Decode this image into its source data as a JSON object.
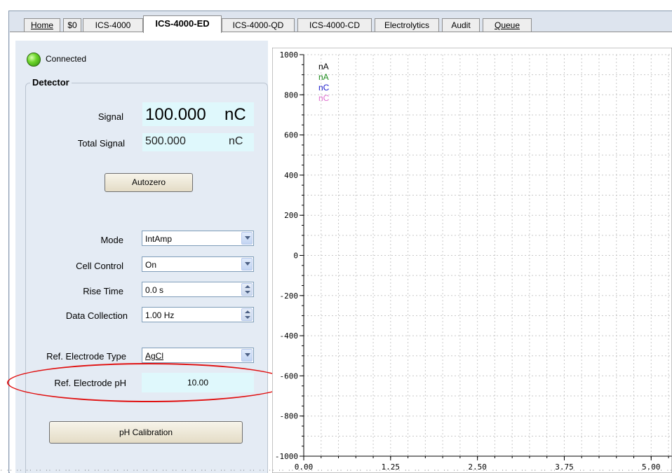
{
  "tabs": [
    {
      "label": "Home",
      "active": false
    },
    {
      "label": "$0",
      "active": false
    },
    {
      "label": "ICS-4000",
      "active": false
    },
    {
      "label": "ICS-4000-ED",
      "active": true
    },
    {
      "label": "ICS-4000-QD",
      "active": false
    },
    {
      "label": "ICS-4000-CD",
      "active": false
    },
    {
      "label": "Electrolytics",
      "active": false
    },
    {
      "label": "Audit",
      "active": false
    },
    {
      "label": "Queue",
      "active": false
    }
  ],
  "status": {
    "label": "Connected"
  },
  "detector": {
    "title": "Detector",
    "signal_label": "Signal",
    "signal_value": "100.000",
    "signal_unit": "nC",
    "total_label": "Total Signal",
    "total_value": "500.000",
    "total_unit": "nC",
    "autozero_label": "Autozero",
    "mode_label": "Mode",
    "mode_value": "IntAmp",
    "cell_label": "Cell Control",
    "cell_value": "On",
    "rise_label": "Rise Time",
    "rise_value": "0.0 s",
    "collection_label": "Data Collection",
    "collection_value": "1.00 Hz",
    "electrode_type_label": "Ref. Electrode Type",
    "electrode_type_value": "AgCl",
    "electrode_ph_label": "Ref. Electrode pH",
    "electrode_ph_value": "10.00",
    "ph_button_label": "pH Calibration"
  },
  "colors": {
    "accent_highlight": "#e01010",
    "value_bg": "#dff8fc",
    "panel_bg": "#e4ebf4"
  },
  "chart_data": {
    "type": "line",
    "yticks": [
      "1000",
      "800",
      "600",
      "400",
      "200",
      "0",
      "-200",
      "-400",
      "-600",
      "-800",
      "-1000"
    ],
    "xticks": [
      "0.00",
      "1.25",
      "2.50",
      "3.75",
      "5.00"
    ],
    "ylim": [
      -1000,
      1000
    ],
    "xlim": [
      0,
      5.3
    ],
    "grid": true,
    "series": [
      {
        "name": "nA",
        "color": "#000000",
        "values": []
      },
      {
        "name": "nA",
        "color": "#1a8a1a",
        "values": []
      },
      {
        "name": "nC",
        "color": "#1a1acc",
        "values": []
      },
      {
        "name": "nC",
        "color": "#e070d0",
        "values": []
      }
    ]
  }
}
